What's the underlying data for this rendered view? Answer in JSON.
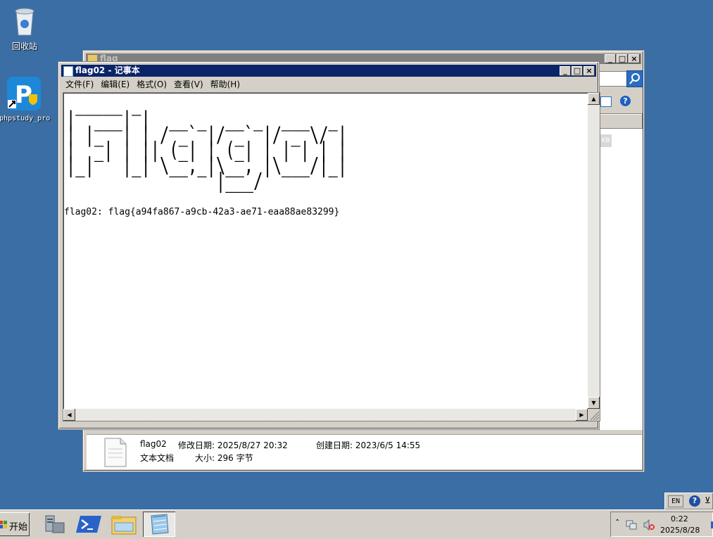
{
  "desktop": {
    "icons": [
      {
        "label": "回收站"
      },
      {
        "label": "phpstudy_pro"
      }
    ]
  },
  "explorer": {
    "title": "flag",
    "size_col": "KB",
    "details": {
      "name": "flag02",
      "type": "文本文档",
      "modified": "修改日期: 2025/8/27 20:32",
      "created": "创建日期: 2023/6/5 14:55",
      "size": "大小: 296 字节"
    }
  },
  "notepad": {
    "title": "flag02 - 记事本",
    "menu": [
      "文件(F)",
      "编辑(E)",
      "格式(O)",
      "查看(V)",
      "帮助(H)"
    ],
    "ascii_art": " _____ _\n|  ___| |  __ _  __ _  ___  _\n| |_  | | / _` |/ _` |/ _ \\/ |\n|  _| | || (_| | (_| | | | | |\n|_|   |_| \\__,_|\\__, |\\___/|_|\n                |___/",
    "flag_line": "flag02: flag{a94fa867-a9cb-42a3-ae71-eaa88ae83299}"
  },
  "taskbar": {
    "start_label": "开始",
    "lang": "EN",
    "time": "0:22",
    "date": "2025/8/28"
  },
  "colors": {
    "desktop": "#3a6ea5",
    "title_active": "#0a246a"
  }
}
